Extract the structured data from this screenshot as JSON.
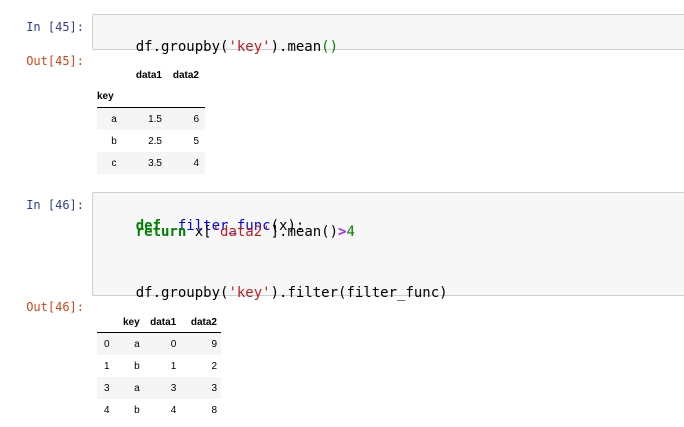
{
  "cell45": {
    "in_prompt": "In [45]:",
    "code_parts": [
      "df.groupby(",
      "'key'",
      ").mean",
      "()"
    ],
    "out_prompt": "Out[45]:",
    "table": {
      "columns": [
        "data1",
        "data2"
      ],
      "index_name": "key",
      "rows": [
        {
          "index": "a",
          "values": [
            "1.5",
            "6"
          ]
        },
        {
          "index": "b",
          "values": [
            "2.5",
            "5"
          ]
        },
        {
          "index": "c",
          "values": [
            "3.5",
            "4"
          ]
        }
      ]
    }
  },
  "cell46": {
    "in_prompt": "In [46]:",
    "line1": {
      "kw": "def",
      "fn": "filter_func",
      "rest": "(x):"
    },
    "line2": {
      "kw": "return",
      "a": "x[",
      "str": "'data2'",
      "b": "].mean()",
      "op": ">",
      "num": "4"
    },
    "line3": {
      "a": "df.groupby(",
      "str": "'key'",
      "b": ").filter(filter_func)"
    },
    "out_prompt": "Out[46]:",
    "table": {
      "columns": [
        "key",
        "data1",
        "data2"
      ],
      "rows": [
        {
          "index": "0",
          "values": [
            "a",
            "0",
            "9"
          ]
        },
        {
          "index": "1",
          "values": [
            "b",
            "1",
            "2"
          ]
        },
        {
          "index": "3",
          "values": [
            "a",
            "3",
            "3"
          ]
        },
        {
          "index": "4",
          "values": [
            "b",
            "4",
            "8"
          ]
        }
      ]
    }
  }
}
